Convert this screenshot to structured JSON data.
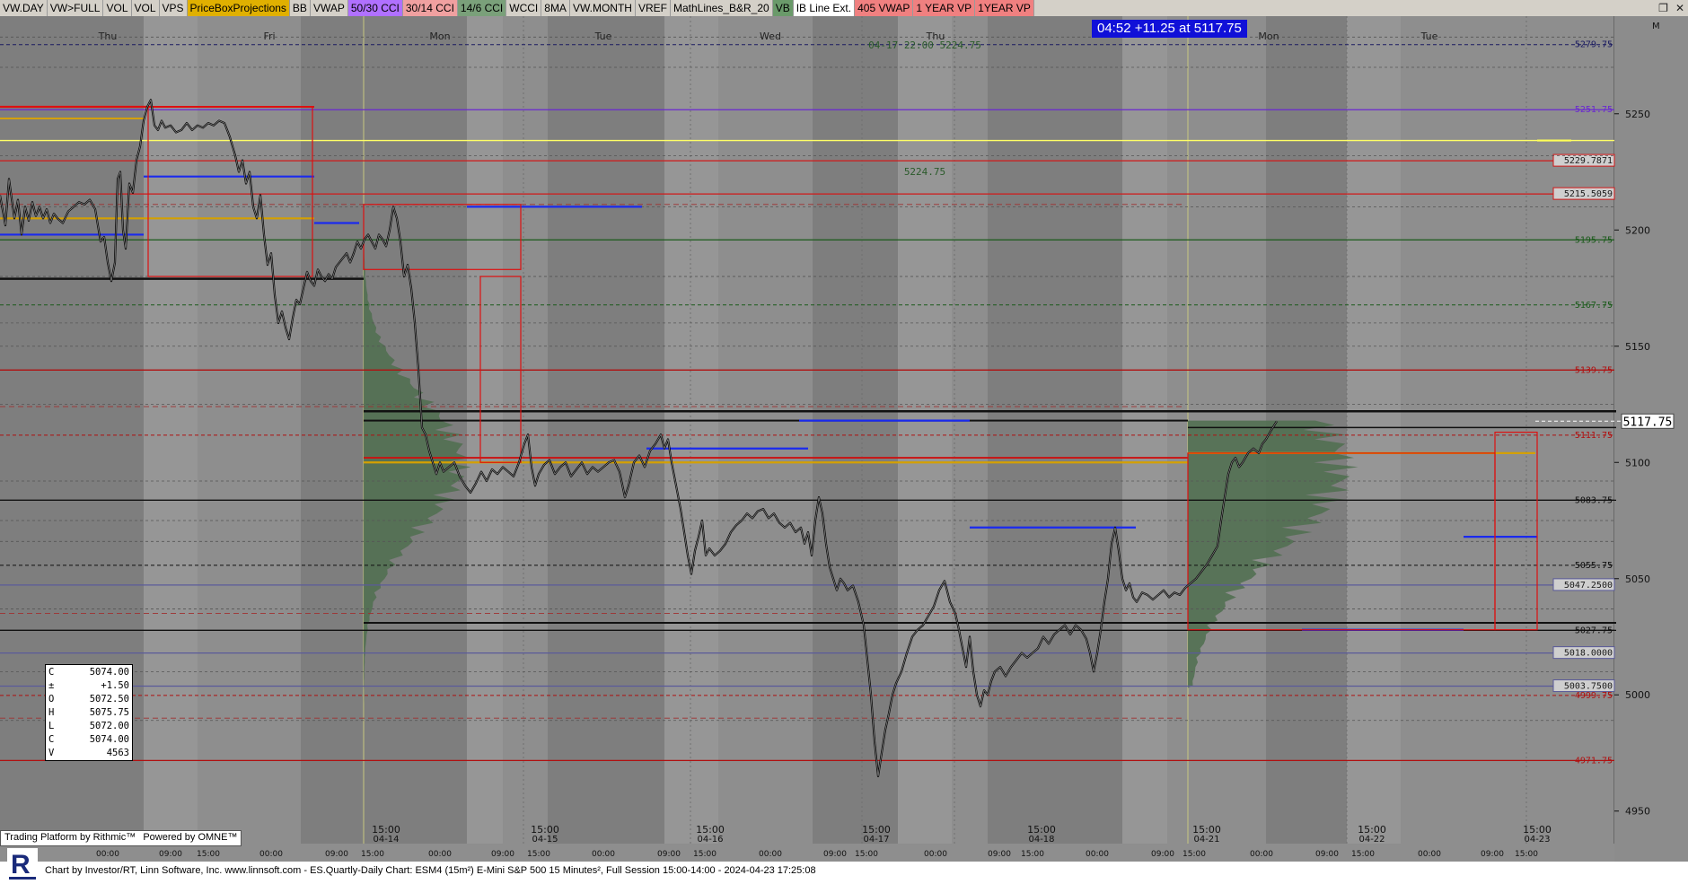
{
  "toolbar": {
    "buttons": [
      {
        "label": "VW.DAY",
        "bg": "#d4d0c8"
      },
      {
        "label": "VW>FULL",
        "bg": "#d4d0c8"
      },
      {
        "label": "VOL",
        "bg": "#d4d0c8"
      },
      {
        "label": "VOL",
        "bg": "#d4d0c8"
      },
      {
        "label": "VPS",
        "bg": "#d4d0c8"
      },
      {
        "label": "PriceBoxProjections",
        "bg": "#e0b000"
      },
      {
        "label": "BB",
        "bg": "#d4d0c8"
      },
      {
        "label": "VWAP",
        "bg": "#d4d0c8"
      },
      {
        "label": "50/30 CCI",
        "bg": "#b070ff"
      },
      {
        "label": "30/14 CCI",
        "bg": "#f0a0a0"
      },
      {
        "label": "14/6 CCI",
        "bg": "#7aa07a"
      },
      {
        "label": "WCCI",
        "bg": "#d4d0c8"
      },
      {
        "label": "8MA",
        "bg": "#d4d0c8"
      },
      {
        "label": "VW.MONTH",
        "bg": "#d4d0c8"
      },
      {
        "label": "VREF",
        "bg": "#d4d0c8"
      },
      {
        "label": "MathLines_B&R_20",
        "bg": "#d4d0c8"
      },
      {
        "label": "VB",
        "bg": "#6a9a6a"
      },
      {
        "label": "IB Line Ext.",
        "bg": "#ffffff"
      },
      {
        "label": "405 VWAP",
        "bg": "#f08080"
      },
      {
        "label": "1 YEAR VP",
        "bg": "#f08080"
      },
      {
        "label": "1YEAR VP",
        "bg": "#f08080"
      }
    ],
    "window_icons": [
      "restore-icon",
      "close-icon"
    ]
  },
  "header": {
    "last_price_banner": "04:52  +11.25 at 5117.75",
    "annotation_top": "04-17 22:00  5224.75",
    "annotation_mid": "5224.75",
    "m_marker": "M"
  },
  "ohlc_box": {
    "rows": [
      {
        "k": "C",
        "v": "5074.00"
      },
      {
        "k": "±",
        "v": "+1.50"
      },
      {
        "k": "O",
        "v": "5072.50"
      },
      {
        "k": "H",
        "v": "5075.75"
      },
      {
        "k": "L",
        "v": "5072.00"
      },
      {
        "k": "C",
        "v": "5074.00"
      },
      {
        "k": "V",
        "v": "4563"
      }
    ]
  },
  "branding": {
    "rithmic": "Trading Platform by Rithmic™",
    "omne": "Powered by OMNE™",
    "footer": "Chart by Investor/RT, Linn Software, Inc. www.linnsoft.com - ES.Quartly-Daily Chart: ESM4 (15m²) E-Mini S&P 500 15 Minutes², Full Session 15:00-14:00 - 2024-04-23 17:25:08",
    "logo_letter": "R"
  },
  "chart_data": {
    "type": "line",
    "instrument": "ESM4 15m",
    "ylim": [
      4945,
      5290
    ],
    "yticks": [
      4950,
      5000,
      5050,
      5100,
      5150,
      5200,
      5250
    ],
    "day_labels": [
      "Thu",
      "Fri",
      "Mon",
      "Tue",
      "Wed",
      "Thu",
      "Mon",
      "Tue"
    ],
    "session_date_labels": [
      "04-14",
      "04-15",
      "04-16",
      "04-17",
      "04-18",
      "04-21",
      "04-22",
      "04-23"
    ],
    "session_time_label": "15:00",
    "hour_labels": [
      "00:00",
      "09:00",
      "15:00"
    ],
    "last_price": "5117.75",
    "price_path": [
      [
        0,
        5215
      ],
      [
        6,
        5202
      ],
      [
        10,
        5222
      ],
      [
        16,
        5205
      ],
      [
        20,
        5213
      ],
      [
        24,
        5198
      ],
      [
        28,
        5210
      ],
      [
        32,
        5204
      ],
      [
        36,
        5212
      ],
      [
        40,
        5206
      ],
      [
        44,
        5210
      ],
      [
        48,
        5205
      ],
      [
        52,
        5209
      ],
      [
        56,
        5203
      ],
      [
        60,
        5207
      ],
      [
        64,
        5205
      ],
      [
        70,
        5203
      ],
      [
        76,
        5208
      ],
      [
        82,
        5210
      ],
      [
        88,
        5212
      ],
      [
        94,
        5211
      ],
      [
        100,
        5213
      ],
      [
        106,
        5209
      ],
      [
        112,
        5195
      ],
      [
        116,
        5197
      ],
      [
        120,
        5186
      ],
      [
        124,
        5178
      ],
      [
        128,
        5186
      ],
      [
        131,
        5222
      ],
      [
        134,
        5225
      ],
      [
        137,
        5200
      ],
      [
        140,
        5192
      ],
      [
        144,
        5220
      ],
      [
        148,
        5216
      ],
      [
        152,
        5230
      ],
      [
        156,
        5236
      ],
      [
        160,
        5247
      ],
      [
        164,
        5253
      ],
      [
        168,
        5256
      ],
      [
        172,
        5245
      ],
      [
        176,
        5243
      ],
      [
        180,
        5247
      ],
      [
        184,
        5244
      ],
      [
        190,
        5245
      ],
      [
        196,
        5242
      ],
      [
        202,
        5243
      ],
      [
        208,
        5246
      ],
      [
        214,
        5243
      ],
      [
        220,
        5245
      ],
      [
        226,
        5244
      ],
      [
        232,
        5246
      ],
      [
        238,
        5245
      ],
      [
        244,
        5247
      ],
      [
        250,
        5246
      ],
      [
        256,
        5240
      ],
      [
        262,
        5232
      ],
      [
        266,
        5225
      ],
      [
        270,
        5230
      ],
      [
        274,
        5220
      ],
      [
        278,
        5225
      ],
      [
        282,
        5210
      ],
      [
        286,
        5205
      ],
      [
        290,
        5215
      ],
      [
        294,
        5198
      ],
      [
        298,
        5185
      ],
      [
        302,
        5190
      ],
      [
        306,
        5172
      ],
      [
        310,
        5160
      ],
      [
        314,
        5165
      ],
      [
        318,
        5158
      ],
      [
        322,
        5153
      ],
      [
        326,
        5162
      ],
      [
        330,
        5170
      ],
      [
        334,
        5168
      ],
      [
        338,
        5175
      ],
      [
        342,
        5182
      ],
      [
        346,
        5178
      ],
      [
        350,
        5176
      ],
      [
        354,
        5183
      ],
      [
        358,
        5180
      ],
      [
        362,
        5178
      ],
      [
        366,
        5181
      ],
      [
        370,
        5179
      ],
      [
        374,
        5184
      ],
      [
        378,
        5186
      ],
      [
        382,
        5188
      ],
      [
        386,
        5190
      ],
      [
        390,
        5186
      ],
      [
        394,
        5190
      ],
      [
        398,
        5195
      ],
      [
        402,
        5192
      ],
      [
        406,
        5196
      ],
      [
        410,
        5198
      ],
      [
        414,
        5195
      ],
      [
        418,
        5192
      ],
      [
        422,
        5198
      ],
      [
        426,
        5196
      ],
      [
        430,
        5193
      ],
      [
        434,
        5200
      ],
      [
        438,
        5210
      ],
      [
        442,
        5205
      ],
      [
        446,
        5195
      ],
      [
        450,
        5180
      ],
      [
        454,
        5185
      ],
      [
        458,
        5175
      ],
      [
        462,
        5160
      ],
      [
        466,
        5140
      ],
      [
        470,
        5115
      ],
      [
        474,
        5112
      ],
      [
        478,
        5105
      ],
      [
        482,
        5100
      ],
      [
        486,
        5095
      ],
      [
        490,
        5100
      ],
      [
        494,
        5096
      ],
      [
        500,
        5098
      ],
      [
        506,
        5100
      ],
      [
        512,
        5094
      ],
      [
        518,
        5090
      ],
      [
        524,
        5087
      ],
      [
        530,
        5091
      ],
      [
        536,
        5096
      ],
      [
        542,
        5092
      ],
      [
        548,
        5097
      ],
      [
        554,
        5095
      ],
      [
        560,
        5098
      ],
      [
        566,
        5096
      ],
      [
        572,
        5094
      ],
      [
        578,
        5100
      ],
      [
        584,
        5108
      ],
      [
        588,
        5112
      ],
      [
        592,
        5098
      ],
      [
        596,
        5090
      ],
      [
        600,
        5095
      ],
      [
        606,
        5099
      ],
      [
        612,
        5101
      ],
      [
        618,
        5095
      ],
      [
        624,
        5098
      ],
      [
        630,
        5100
      ],
      [
        636,
        5094
      ],
      [
        642,
        5097
      ],
      [
        648,
        5100
      ],
      [
        654,
        5095
      ],
      [
        660,
        5098
      ],
      [
        666,
        5096
      ],
      [
        672,
        5098
      ],
      [
        678,
        5100
      ],
      [
        684,
        5101
      ],
      [
        690,
        5096
      ],
      [
        696,
        5085
      ],
      [
        700,
        5090
      ],
      [
        706,
        5100
      ],
      [
        712,
        5103
      ],
      [
        718,
        5098
      ],
      [
        724,
        5105
      ],
      [
        730,
        5108
      ],
      [
        736,
        5112
      ],
      [
        740,
        5106
      ],
      [
        744,
        5110
      ],
      [
        748,
        5100
      ],
      [
        754,
        5088
      ],
      [
        758,
        5080
      ],
      [
        762,
        5070
      ],
      [
        766,
        5060
      ],
      [
        770,
        5052
      ],
      [
        774,
        5062
      ],
      [
        778,
        5068
      ],
      [
        782,
        5075
      ],
      [
        786,
        5060
      ],
      [
        790,
        5063
      ],
      [
        796,
        5060
      ],
      [
        802,
        5062
      ],
      [
        808,
        5065
      ],
      [
        814,
        5070
      ],
      [
        820,
        5073
      ],
      [
        826,
        5075
      ],
      [
        832,
        5078
      ],
      [
        838,
        5076
      ],
      [
        844,
        5079
      ],
      [
        850,
        5080
      ],
      [
        856,
        5076
      ],
      [
        862,
        5078
      ],
      [
        868,
        5074
      ],
      [
        874,
        5072
      ],
      [
        880,
        5074
      ],
      [
        886,
        5070
      ],
      [
        892,
        5072
      ],
      [
        896,
        5065
      ],
      [
        900,
        5070
      ],
      [
        904,
        5060
      ],
      [
        908,
        5075
      ],
      [
        912,
        5085
      ],
      [
        916,
        5078
      ],
      [
        920,
        5065
      ],
      [
        924,
        5055
      ],
      [
        928,
        5050
      ],
      [
        932,
        5045
      ],
      [
        936,
        5050
      ],
      [
        940,
        5048
      ],
      [
        944,
        5045
      ],
      [
        950,
        5047
      ],
      [
        956,
        5040
      ],
      [
        962,
        5030
      ],
      [
        966,
        5015
      ],
      [
        970,
        5000
      ],
      [
        974,
        4980
      ],
      [
        978,
        4965
      ],
      [
        982,
        4975
      ],
      [
        986,
        4985
      ],
      [
        990,
        4992
      ],
      [
        994,
        5000
      ],
      [
        998,
        5005
      ],
      [
        1004,
        5010
      ],
      [
        1010,
        5018
      ],
      [
        1016,
        5025
      ],
      [
        1022,
        5028
      ],
      [
        1028,
        5030
      ],
      [
        1034,
        5034
      ],
      [
        1040,
        5038
      ],
      [
        1046,
        5045
      ],
      [
        1052,
        5049
      ],
      [
        1058,
        5040
      ],
      [
        1064,
        5035
      ],
      [
        1068,
        5028
      ],
      [
        1072,
        5020
      ],
      [
        1076,
        5012
      ],
      [
        1080,
        5025
      ],
      [
        1084,
        5010
      ],
      [
        1088,
        5000
      ],
      [
        1092,
        4995
      ],
      [
        1096,
        5002
      ],
      [
        1100,
        5000
      ],
      [
        1104,
        5006
      ],
      [
        1108,
        5010
      ],
      [
        1114,
        5012
      ],
      [
        1120,
        5008
      ],
      [
        1126,
        5012
      ],
      [
        1132,
        5015
      ],
      [
        1138,
        5018
      ],
      [
        1144,
        5016
      ],
      [
        1150,
        5018
      ],
      [
        1156,
        5020
      ],
      [
        1162,
        5025
      ],
      [
        1168,
        5022
      ],
      [
        1174,
        5026
      ],
      [
        1180,
        5028
      ],
      [
        1186,
        5030
      ],
      [
        1192,
        5026
      ],
      [
        1198,
        5030
      ],
      [
        1204,
        5028
      ],
      [
        1210,
        5024
      ],
      [
        1214,
        5018
      ],
      [
        1218,
        5010
      ],
      [
        1222,
        5018
      ],
      [
        1226,
        5028
      ],
      [
        1230,
        5040
      ],
      [
        1234,
        5050
      ],
      [
        1238,
        5065
      ],
      [
        1242,
        5072
      ],
      [
        1246,
        5062
      ],
      [
        1250,
        5050
      ],
      [
        1254,
        5045
      ],
      [
        1258,
        5048
      ],
      [
        1262,
        5042
      ],
      [
        1266,
        5040
      ],
      [
        1272,
        5044
      ],
      [
        1278,
        5043
      ],
      [
        1284,
        5041
      ],
      [
        1290,
        5043
      ],
      [
        1296,
        5045
      ],
      [
        1302,
        5042
      ],
      [
        1308,
        5044
      ],
      [
        1314,
        5043
      ],
      [
        1320,
        5046
      ],
      [
        1326,
        5048
      ],
      [
        1332,
        5050
      ],
      [
        1338,
        5053
      ],
      [
        1344,
        5056
      ],
      [
        1350,
        5060
      ],
      [
        1356,
        5064
      ],
      [
        1360,
        5075
      ],
      [
        1364,
        5085
      ],
      [
        1368,
        5095
      ],
      [
        1372,
        5100
      ],
      [
        1376,
        5102
      ],
      [
        1380,
        5098
      ],
      [
        1384,
        5100
      ],
      [
        1390,
        5104
      ],
      [
        1396,
        5106
      ],
      [
        1402,
        5104
      ],
      [
        1406,
        5108
      ],
      [
        1410,
        5110
      ],
      [
        1416,
        5114
      ],
      [
        1422,
        5117.75
      ]
    ],
    "horizontal_levels": [
      {
        "y": 5279.75,
        "color": "#1a1a60",
        "dash": true,
        "label": "5279.75",
        "boxed": false
      },
      {
        "y": 5251.75,
        "color": "#6a28d0",
        "dash": false,
        "label": "5251.75",
        "boxed": false
      },
      {
        "y": 5238.5,
        "color": "#ffff66",
        "dash": false,
        "label": "",
        "boxed": false
      },
      {
        "y": 5229.7871,
        "color": "#d01818",
        "dash": false,
        "label": "5229.7871",
        "boxed": true
      },
      {
        "y": 5215.5059,
        "color": "#d01818",
        "dash": false,
        "label": "5215.5059",
        "boxed": true
      },
      {
        "y": 5195.75,
        "color": "#1a5a1a",
        "dash": false,
        "label": "5195.75",
        "boxed": false
      },
      {
        "y": 5167.75,
        "color": "#1a5a1a",
        "dash": true,
        "label": "5167.75",
        "boxed": false
      },
      {
        "y": 5139.75,
        "color": "#b01010",
        "dash": false,
        "label": "5139.75",
        "boxed": false
      },
      {
        "y": 5111.75,
        "color": "#b01010",
        "dash": true,
        "label": "5111.75",
        "boxed": false
      },
      {
        "y": 5083.75,
        "color": "#101010",
        "dash": false,
        "label": "5083.75",
        "boxed": false
      },
      {
        "y": 5055.75,
        "color": "#101010",
        "dash": true,
        "label": "5055.75",
        "boxed": false
      },
      {
        "y": 5047.25,
        "color": "#5a5a9a",
        "dash": false,
        "label": "5047.2500",
        "boxed": true
      },
      {
        "y": 5027.75,
        "color": "#101010",
        "dash": false,
        "label": "5027.75",
        "boxed": false
      },
      {
        "y": 5018.0,
        "color": "#5a5a9a",
        "dash": false,
        "label": "5018.0000",
        "boxed": true
      },
      {
        "y": 5003.75,
        "color": "#5a5a9a",
        "dash": false,
        "label": "5003.7500",
        "boxed": true
      },
      {
        "y": 4999.75,
        "color": "#b01010",
        "dash": true,
        "label": "4999.75",
        "boxed": false
      },
      {
        "y": 4971.75,
        "color": "#b01010",
        "dash": false,
        "label": "4971.75",
        "boxed": false
      }
    ]
  }
}
